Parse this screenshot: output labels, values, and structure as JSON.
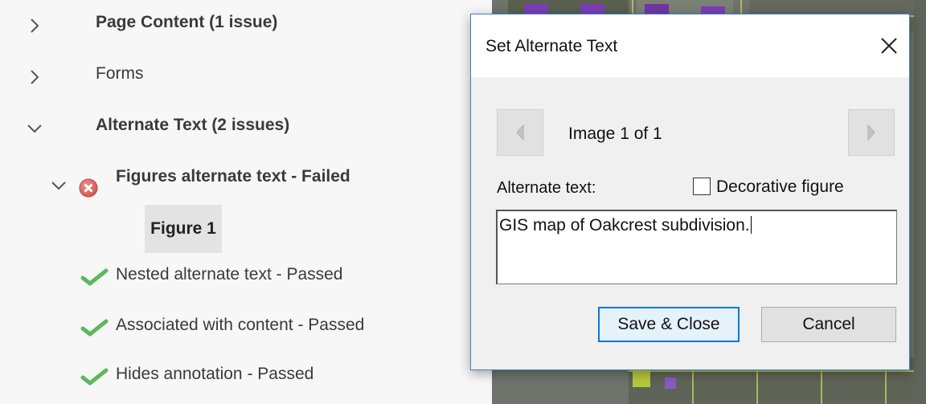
{
  "panel": {
    "rows": [
      {
        "label": "Page Content (1 issue)"
      },
      {
        "label": "Forms"
      },
      {
        "label": "Alternate Text (2 issues)"
      },
      {
        "label": "Figures alternate text - Failed"
      },
      {
        "label": "Figure 1"
      },
      {
        "label": "Nested alternate text - Passed"
      },
      {
        "label": "Associated with content - Passed"
      },
      {
        "label": "Hides annotation - Passed"
      }
    ]
  },
  "dialog": {
    "title": "Set Alternate Text",
    "nav_text": "Image 1 of 1",
    "alt_label": "Alternate text:",
    "decorative_label": "Decorative figure",
    "decorative_checked": false,
    "alt_value": "GIS map of Oakcrest subdivision.",
    "save_label": "Save & Close",
    "cancel_label": "Cancel"
  },
  "colors": {
    "failed": "#d9534f",
    "passed": "#5cb85c",
    "dialog_border": "#3f7fc6",
    "primary_border": "#0a78d7"
  }
}
